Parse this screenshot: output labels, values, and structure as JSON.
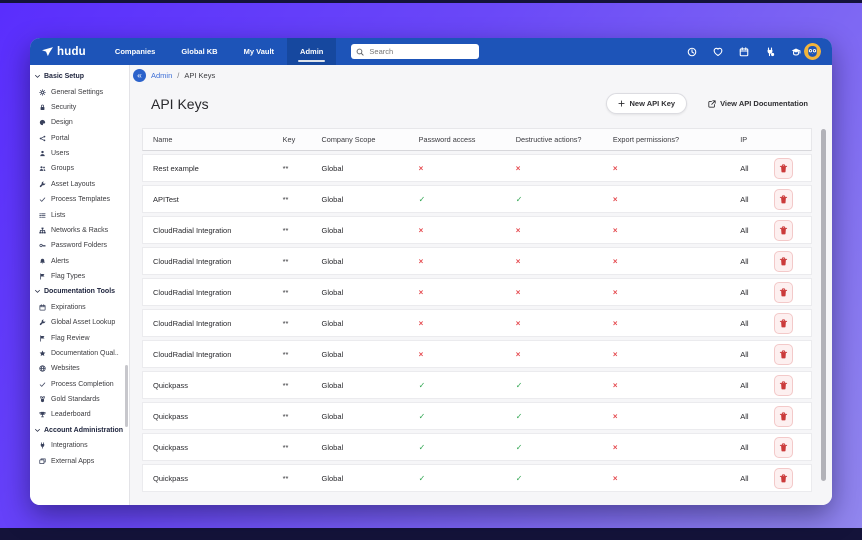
{
  "navbar": {
    "logo_text": "hudu",
    "menu": [
      {
        "label": "Companies",
        "active": false
      },
      {
        "label": "Global KB",
        "active": false
      },
      {
        "label": "My Vault",
        "active": false
      },
      {
        "label": "Admin",
        "active": true
      }
    ],
    "search_placeholder": "Search",
    "right_icons": [
      {
        "name": "clock-icon",
        "glyph": "clock"
      },
      {
        "name": "heart-icon",
        "glyph": "heart"
      },
      {
        "name": "calendar-icon",
        "glyph": "calendar"
      },
      {
        "name": "integrations-plug-icon",
        "glyph": "plugcheck"
      },
      {
        "name": "training-cap-icon",
        "glyph": "gradcap"
      }
    ]
  },
  "sidebar": {
    "sections": [
      {
        "header": "Basic Setup",
        "items": [
          {
            "icon": "gear",
            "label": "General Settings"
          },
          {
            "icon": "lock",
            "label": "Security"
          },
          {
            "icon": "palette",
            "label": "Design"
          },
          {
            "icon": "share",
            "label": "Portal"
          },
          {
            "icon": "user",
            "label": "Users"
          },
          {
            "icon": "users",
            "label": "Groups"
          },
          {
            "icon": "wrench",
            "label": "Asset Layouts"
          },
          {
            "icon": "check",
            "label": "Process Templates"
          },
          {
            "icon": "list",
            "label": "Lists"
          },
          {
            "icon": "network",
            "label": "Networks & Racks"
          },
          {
            "icon": "key",
            "label": "Password Folders"
          },
          {
            "icon": "bell",
            "label": "Alerts"
          },
          {
            "icon": "flag",
            "label": "Flag Types"
          }
        ]
      },
      {
        "header": "Documentation Tools",
        "items": [
          {
            "icon": "calendar",
            "label": "Expirations"
          },
          {
            "icon": "wrench",
            "label": "Global Asset Lookup"
          },
          {
            "icon": "flag",
            "label": "Flag Review"
          },
          {
            "icon": "star",
            "label": "Documentation Qual.."
          },
          {
            "icon": "globe",
            "label": "Websites"
          },
          {
            "icon": "check",
            "label": "Process Completion"
          },
          {
            "icon": "medal",
            "label": "Gold Standards"
          },
          {
            "icon": "trophy",
            "label": "Leaderboard"
          }
        ]
      },
      {
        "header": "Account Administration",
        "items": [
          {
            "icon": "plug",
            "label": "Integrations"
          },
          {
            "icon": "apps",
            "label": "External Apps"
          }
        ]
      }
    ]
  },
  "breadcrumb": {
    "back_glyph": "«",
    "section": "Admin",
    "separator": "/",
    "current": "API Keys"
  },
  "page": {
    "title": "API Keys",
    "new_button": "New API Key",
    "docs_button": "View API Documentation"
  },
  "table": {
    "columns": [
      "Name",
      "Key",
      "Company Scope",
      "Password access",
      "Destructive actions?",
      "Export permissions?",
      "IP"
    ],
    "glyphs": {
      "yes": "✓",
      "no": "×"
    },
    "rows": [
      {
        "name": "Rest example",
        "key": "**",
        "scope": "Global",
        "password_access": false,
        "destructive_actions": false,
        "export_permissions": false,
        "ip": "All"
      },
      {
        "name": "APITest",
        "key": "**",
        "scope": "Global",
        "password_access": true,
        "destructive_actions": true,
        "export_permissions": false,
        "ip": "All"
      },
      {
        "name": "CloudRadial Integration",
        "key": "**",
        "scope": "Global",
        "password_access": false,
        "destructive_actions": false,
        "export_permissions": false,
        "ip": "All"
      },
      {
        "name": "CloudRadial Integration",
        "key": "**",
        "scope": "Global",
        "password_access": false,
        "destructive_actions": false,
        "export_permissions": false,
        "ip": "All"
      },
      {
        "name": "CloudRadial Integration",
        "key": "**",
        "scope": "Global",
        "password_access": false,
        "destructive_actions": false,
        "export_permissions": false,
        "ip": "All"
      },
      {
        "name": "CloudRadial Integration",
        "key": "**",
        "scope": "Global",
        "password_access": false,
        "destructive_actions": false,
        "export_permissions": false,
        "ip": "All"
      },
      {
        "name": "CloudRadial Integration",
        "key": "**",
        "scope": "Global",
        "password_access": false,
        "destructive_actions": false,
        "export_permissions": false,
        "ip": "All"
      },
      {
        "name": "Quickpass",
        "key": "**",
        "scope": "Global",
        "password_access": true,
        "destructive_actions": true,
        "export_permissions": false,
        "ip": "All"
      },
      {
        "name": "Quickpass",
        "key": "**",
        "scope": "Global",
        "password_access": true,
        "destructive_actions": true,
        "export_permissions": false,
        "ip": "All"
      },
      {
        "name": "Quickpass",
        "key": "**",
        "scope": "Global",
        "password_access": true,
        "destructive_actions": true,
        "export_permissions": false,
        "ip": "All"
      },
      {
        "name": "Quickpass",
        "key": "**",
        "scope": "Global",
        "password_access": true,
        "destructive_actions": true,
        "export_permissions": false,
        "ip": "All"
      }
    ]
  },
  "colors": {
    "navbar_blue": "#1d54b8",
    "active_tab_blue": "#16489f",
    "background_purple": "#5a2efd",
    "frame_navy": "#14133a",
    "check_green": "#2da44e",
    "cross_red": "#e5484d",
    "link_blue": "#3c6ed6",
    "avatar_yellow": "#f2b43c"
  }
}
